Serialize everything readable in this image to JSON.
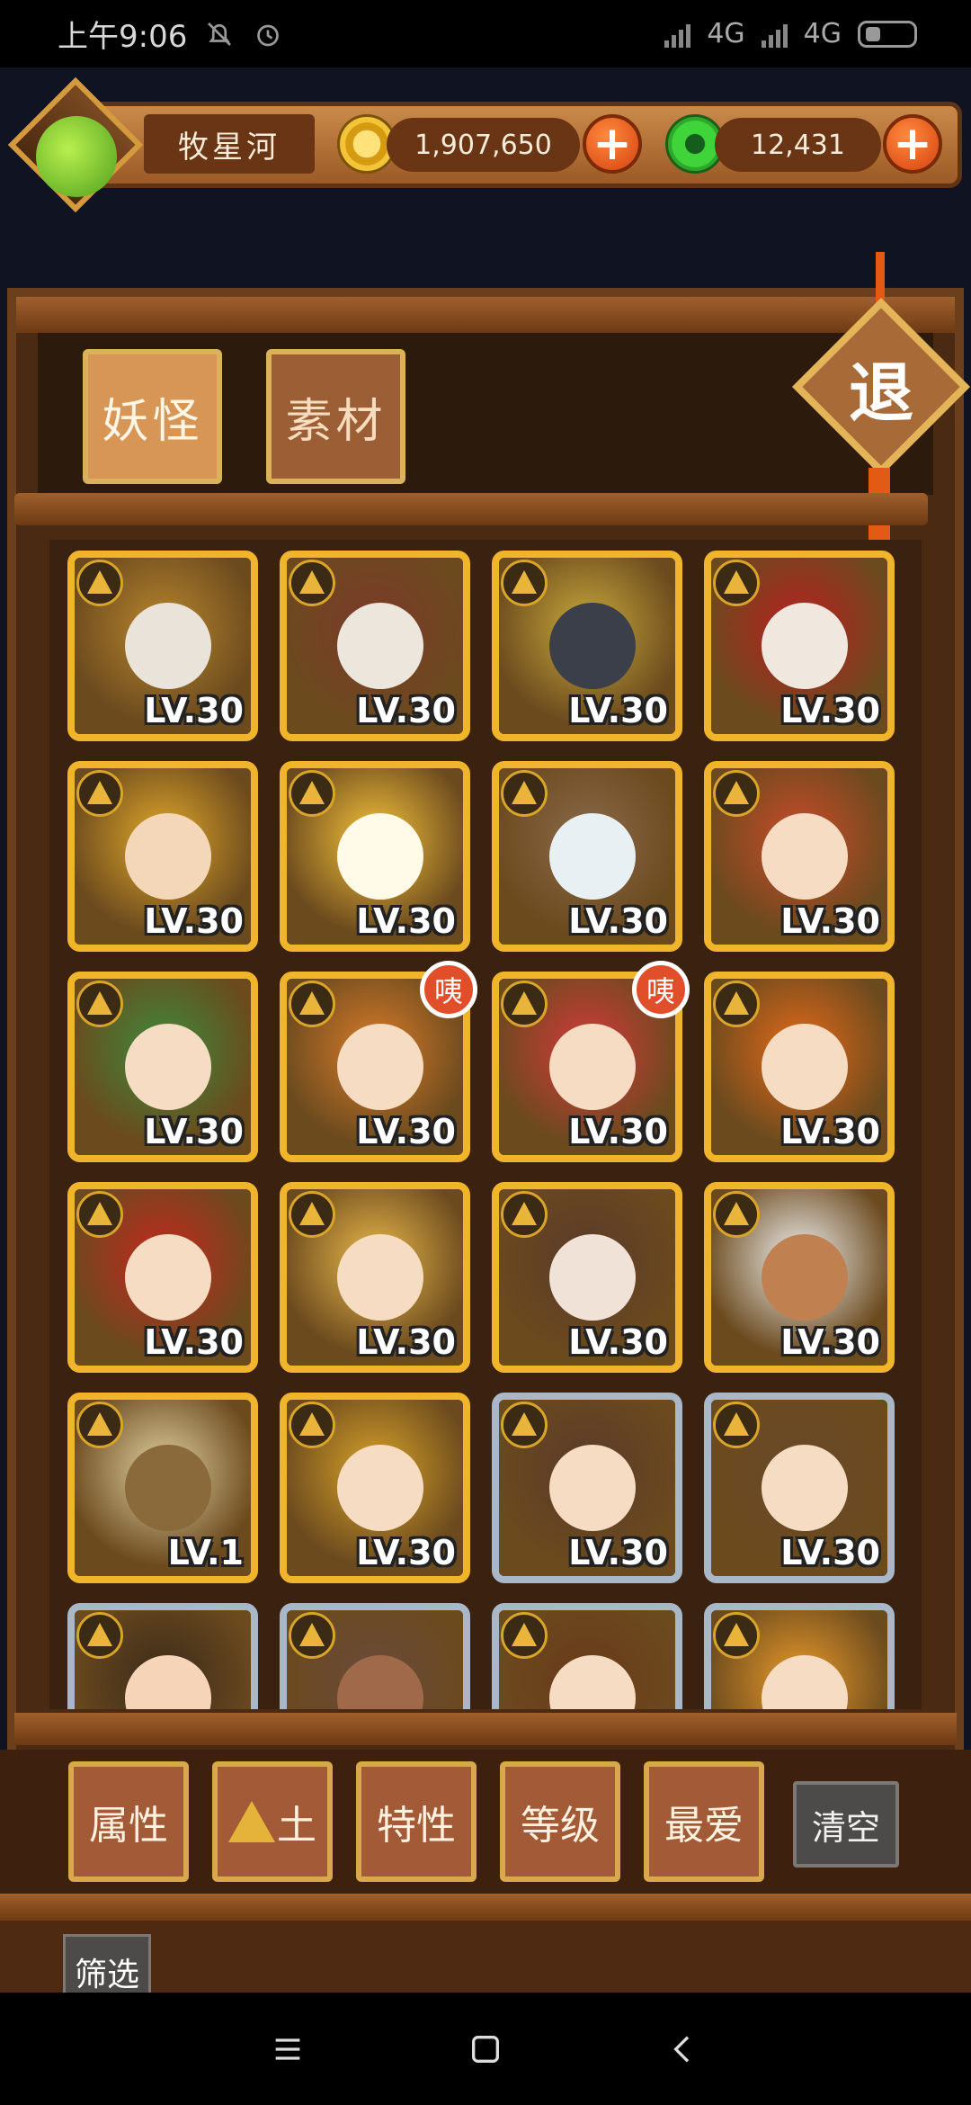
{
  "status_bar": {
    "time": "上午9:06",
    "network_1": "4G",
    "network_2": "4G"
  },
  "header": {
    "player_name": "牧星河",
    "gold_amount": "1,907,650",
    "jade_amount": "12,431",
    "plus_symbol": "+"
  },
  "tabs": [
    {
      "label": "妖怪",
      "active": true
    },
    {
      "label": "素材",
      "active": false
    }
  ],
  "exit_label": "退",
  "monsters": [
    {
      "lv": "LV.30",
      "frame": "gold",
      "palette": [
        "#e9e3d9",
        "#b8862e"
      ]
    },
    {
      "lv": "LV.30",
      "frame": "gold",
      "palette": [
        "#ece6dd",
        "#7c3a2a"
      ]
    },
    {
      "lv": "LV.30",
      "frame": "gold",
      "palette": [
        "#3a3f49",
        "#c8a93b"
      ]
    },
    {
      "lv": "LV.30",
      "frame": "gold",
      "palette": [
        "#f0e8df",
        "#b82020"
      ]
    },
    {
      "lv": "LV.30",
      "frame": "gold",
      "palette": [
        "#f4d6b8",
        "#e0a72a"
      ]
    },
    {
      "lv": "LV.30",
      "frame": "gold",
      "palette": [
        "#fffbe8",
        "#f5c23a"
      ]
    },
    {
      "lv": "LV.30",
      "frame": "gold",
      "palette": [
        "#e8f0f4",
        "#8a6a4a"
      ]
    },
    {
      "lv": "LV.30",
      "frame": "gold",
      "palette": [
        "#f6dcc2",
        "#c94c2a"
      ]
    },
    {
      "lv": "LV.30",
      "frame": "gold",
      "palette": [
        "#f6dcc2",
        "#3e8a3a"
      ]
    },
    {
      "lv": "LV.30",
      "frame": "gold",
      "palette": [
        "#f6dcc2",
        "#d87c2a"
      ],
      "tag": "咦"
    },
    {
      "lv": "LV.30",
      "frame": "gold",
      "palette": [
        "#f6dcc2",
        "#d33a3a"
      ],
      "tag": "咦"
    },
    {
      "lv": "LV.30",
      "frame": "gold",
      "palette": [
        "#f6dcc2",
        "#e46a1a"
      ]
    },
    {
      "lv": "LV.30",
      "frame": "gold",
      "palette": [
        "#f6dcc2",
        "#c4281e"
      ]
    },
    {
      "lv": "LV.30",
      "frame": "gold",
      "palette": [
        "#f6dcc2",
        "#e9b84a"
      ]
    },
    {
      "lv": "LV.30",
      "frame": "gold",
      "palette": [
        "#f0e2d6",
        "#5a3a2a"
      ]
    },
    {
      "lv": "LV.30",
      "frame": "gold",
      "palette": [
        "#c08050",
        "#f0f0f0"
      ]
    },
    {
      "lv": "LV.1",
      "frame": "gold",
      "palette": [
        "#8a6a3a",
        "#e0d0a0"
      ]
    },
    {
      "lv": "LV.30",
      "frame": "gold",
      "palette": [
        "#f6dcc2",
        "#d8a22a"
      ]
    },
    {
      "lv": "LV.30",
      "frame": "silver",
      "palette": [
        "#f6dcc2",
        "#5a3a2a"
      ]
    },
    {
      "lv": "LV.30",
      "frame": "silver",
      "palette": [
        "#f6dcc2",
        "#6a4a2a"
      ]
    },
    {
      "lv": "",
      "frame": "silver",
      "palette": [
        "#f6d4b8",
        "#3a2a1a"
      ]
    },
    {
      "lv": "",
      "frame": "silver",
      "palette": [
        "#a06a4a",
        "#6a4a3a"
      ]
    },
    {
      "lv": "",
      "frame": "silver",
      "palette": [
        "#f6dcc2",
        "#6a3a1a"
      ]
    },
    {
      "lv": "",
      "frame": "silver",
      "palette": [
        "#f6dcc2",
        "#e89a2a"
      ]
    }
  ],
  "filters": [
    {
      "label": "属性"
    },
    {
      "label": "土",
      "icon": "earth-element-icon"
    },
    {
      "label": "特性"
    },
    {
      "label": "等级"
    },
    {
      "label": "最爱"
    }
  ],
  "clear_label": "清空",
  "screen_label": "筛选",
  "nav": {
    "menu_icon": "menu-icon",
    "home_icon": "home-square-icon",
    "back_icon": "back-chevron-icon"
  }
}
